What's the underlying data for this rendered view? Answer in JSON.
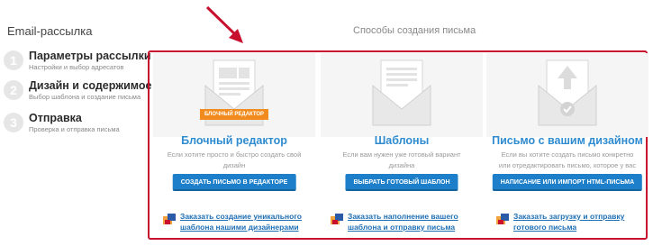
{
  "sidebar": {
    "title": "Email-рассылка",
    "steps": [
      {
        "num": "1",
        "title": "Параметры рассылки",
        "sub": "Настройки и выбор адресатов"
      },
      {
        "num": "2",
        "title": "Дизайн и содержимое",
        "sub": "Выбор шаблона и создание письма"
      },
      {
        "num": "3",
        "title": "Отправка",
        "sub": "Проверка и отправка письма"
      }
    ]
  },
  "main": {
    "title": "Способы создания письма",
    "columns": [
      {
        "badge": "БЛОЧНЫЙ РЕДАКТОР",
        "title": "Блочный редактор",
        "desc": "Если хотите просто и быстро создать свой дизайн",
        "button": "СОЗДАТЬ ПИСЬМО В РЕДАКТОРЕ",
        "order": "Заказать создание уникального шаблона нашими дизайнерами"
      },
      {
        "title": "Шаблоны",
        "desc": "Если вам нужен уже готовый вариант дизайна",
        "button": "ВЫБРАТЬ ГОТОВЫЙ ШАБЛОН",
        "order": "Заказать наполнение вашего шаблона и отправку письма"
      },
      {
        "title": "Письмо с вашим дизайном",
        "desc": "Если вы хотите создать письмо конкретно или отредактировать письмо, которое у вас уже есть",
        "button": "НАПИСАНИЕ ИЛИ ИМПОРТ HTML-ПИСЬМА",
        "order": "Заказать загрузку и отправку готового письма"
      }
    ]
  },
  "colors": {
    "accent": "#2f8bd0",
    "button": "#1d7fc9",
    "frame": "#c8102e",
    "badge": "#f28b1e"
  }
}
